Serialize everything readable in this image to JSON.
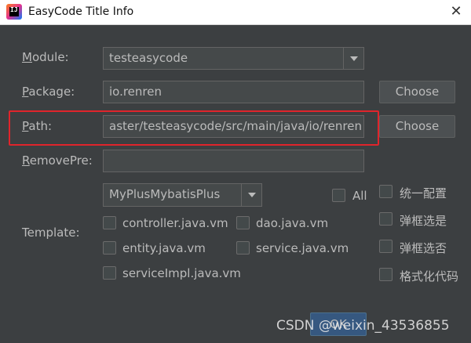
{
  "window": {
    "title": "EasyCode Title Info",
    "close_glyph": "✕"
  },
  "labels": {
    "module": {
      "mnemonic": "M",
      "rest": "odule:"
    },
    "package": {
      "mnemonic": "P",
      "rest": "ackage:"
    },
    "path": {
      "mnemonic": "P",
      "rest": "ath:"
    },
    "remove_pre": {
      "mnemonic": "R",
      "rest": "emovePre:"
    },
    "template": "Template:"
  },
  "fields": {
    "module_value": "testeasycode",
    "package_value": "io.renren",
    "path_value": "aster/testeasycode/src/main/java/io/renren",
    "remove_pre_value": ""
  },
  "buttons": {
    "choose_package": "Choose",
    "choose_path": "Choose",
    "ok": "OK"
  },
  "template_group": {
    "selected": "MyPlusMybatisPlus"
  },
  "checkboxes": {
    "all": "All",
    "controller": "controller.java.vm",
    "dao": "dao.java.vm",
    "entity": "entity.java.vm",
    "service": "service.java.vm",
    "service_impl": "serviceImpl.java.vm"
  },
  "options": {
    "unified_config": "统一配置",
    "dialog_yes": "弹框选是",
    "dialog_no": "弹框选否",
    "format_code": "格式化代码"
  },
  "watermark": "CSDN @weixin_43536855",
  "colors": {
    "highlight": "#e0242b",
    "background": "#3c3f41",
    "ok_button": "#365880"
  }
}
